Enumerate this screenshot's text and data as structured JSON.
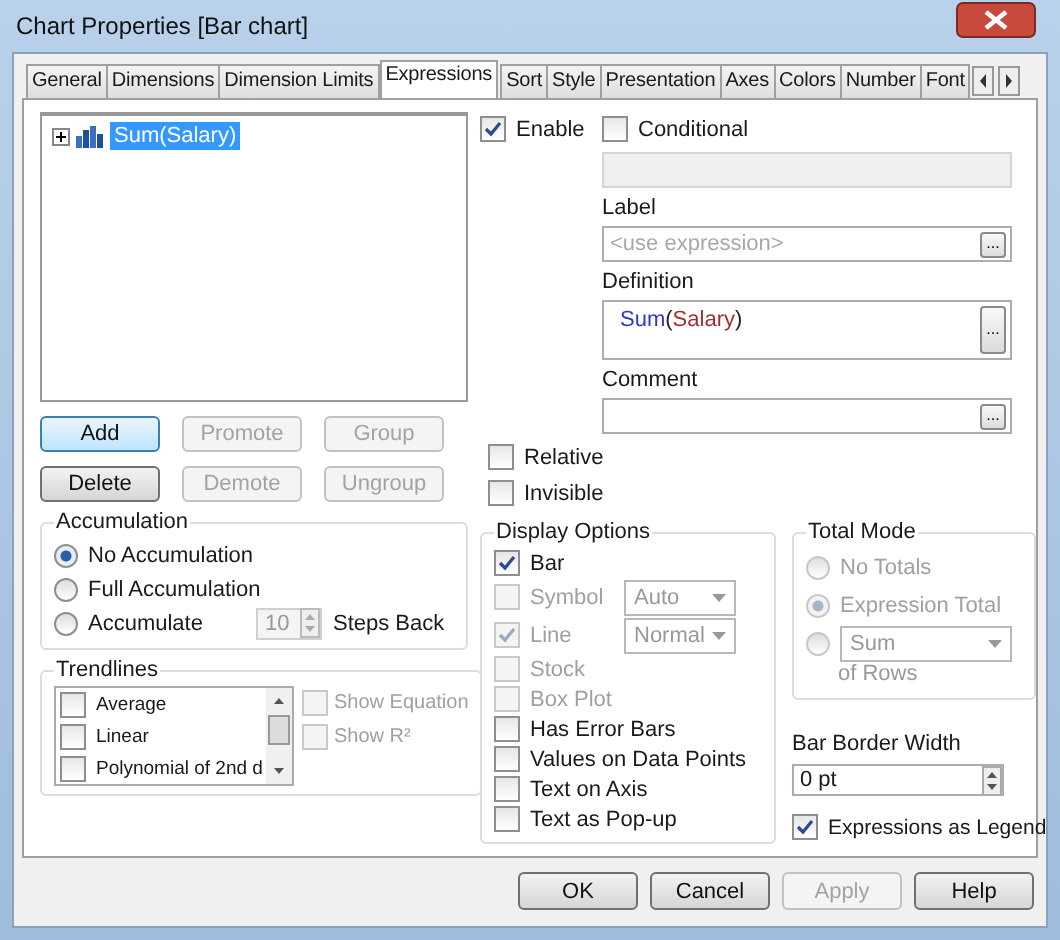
{
  "window": {
    "title": "Chart Properties [Bar chart]"
  },
  "tabs": [
    {
      "label": "General",
      "selected": false
    },
    {
      "label": "Dimensions",
      "selected": false
    },
    {
      "label": "Dimension Limits",
      "selected": false
    },
    {
      "label": "Expressions",
      "selected": true
    },
    {
      "label": "Sort",
      "selected": false
    },
    {
      "label": "Style",
      "selected": false
    },
    {
      "label": "Presentation",
      "selected": false
    },
    {
      "label": "Axes",
      "selected": false
    },
    {
      "label": "Colors",
      "selected": false
    },
    {
      "label": "Number",
      "selected": false
    },
    {
      "label": "Font",
      "selected": false
    }
  ],
  "expression_tree": [
    {
      "label": "Sum(Salary)",
      "selected": true,
      "expanded": false
    }
  ],
  "expression_buttons": [
    {
      "label": "Add",
      "disabled": false,
      "hovered": true
    },
    {
      "label": "Promote",
      "disabled": true,
      "hovered": false
    },
    {
      "label": "Group",
      "disabled": true,
      "hovered": false
    },
    {
      "label": "Delete",
      "disabled": false,
      "hovered": false
    },
    {
      "label": "Demote",
      "disabled": true,
      "hovered": false
    },
    {
      "label": "Ungroup",
      "disabled": true,
      "hovered": false
    }
  ],
  "enable": {
    "label": "Enable",
    "checked": true
  },
  "conditional": {
    "label": "Conditional",
    "checked": false
  },
  "label_field": {
    "heading": "Label",
    "placeholder": "<use expression>",
    "button": "..."
  },
  "definition": {
    "heading": "Definition",
    "parts": [
      {
        "text": "Sum",
        "kind": "function"
      },
      {
        "text": "(",
        "kind": "plain"
      },
      {
        "text": "Salary",
        "kind": "field"
      },
      {
        "text": ")",
        "kind": "plain"
      }
    ],
    "button": "..."
  },
  "comment": {
    "heading": "Comment",
    "button": "..."
  },
  "flags": [
    {
      "label": "Relative",
      "checked": false
    },
    {
      "label": "Invisible",
      "checked": false
    }
  ],
  "accumulation": {
    "title": "Accumulation",
    "options": [
      {
        "label": "No Accumulation",
        "selected": true
      },
      {
        "label": "Full Accumulation",
        "selected": false
      },
      {
        "label": "Accumulate",
        "selected": false
      }
    ],
    "steps": "10",
    "steps_label": "Steps Back"
  },
  "trendlines": {
    "title": "Trendlines",
    "items": [
      {
        "label": "Average",
        "checked": false
      },
      {
        "label": "Linear",
        "checked": false
      },
      {
        "label": "Polynomial of 2nd d",
        "checked": false
      }
    ],
    "show_options": [
      {
        "label": "Show Equation",
        "checked": false,
        "disabled": true
      },
      {
        "label": "Show R²",
        "checked": false,
        "disabled": true
      }
    ]
  },
  "display_options": {
    "title": "Display Options",
    "items": [
      {
        "kind": "checkbox",
        "label": "Bar",
        "checked": true,
        "disabled": false
      },
      {
        "kind": "dropdown",
        "label": "Symbol",
        "checked": false,
        "disabled": true,
        "value": "Auto"
      },
      {
        "kind": "dropdown",
        "label": "Line",
        "checked": true,
        "disabled": true,
        "value": "Normal"
      },
      {
        "kind": "checkbox",
        "label": "Stock",
        "checked": false,
        "disabled": true
      },
      {
        "kind": "checkbox",
        "label": "Box Plot",
        "checked": false,
        "disabled": true
      },
      {
        "kind": "checkbox",
        "label": "Has Error Bars",
        "checked": false,
        "disabled": false
      },
      {
        "kind": "checkbox",
        "label": "Values on Data Points",
        "checked": false,
        "disabled": false
      },
      {
        "kind": "checkbox",
        "label": "Text on Axis",
        "checked": false,
        "disabled": false
      },
      {
        "kind": "checkbox",
        "label": "Text as Pop-up",
        "checked": false,
        "disabled": false
      }
    ]
  },
  "total_mode": {
    "title": "Total Mode",
    "disabled": true,
    "options": [
      {
        "kind": "radio",
        "label": "No Totals",
        "selected": false
      },
      {
        "kind": "radio",
        "label": "Expression Total",
        "selected": true
      },
      {
        "kind": "dropdown",
        "value": "Sum",
        "selected": false
      }
    ],
    "suffix": "of Rows"
  },
  "bar_border_width": {
    "label": "Bar Border Width",
    "value": "0 pt"
  },
  "expressions_as_legend": {
    "label": "Expressions as Legend",
    "checked": true
  },
  "footer_buttons": [
    {
      "label": "OK",
      "disabled": false
    },
    {
      "label": "Cancel",
      "disabled": false
    },
    {
      "label": "Apply",
      "disabled": true
    },
    {
      "label": "Help",
      "disabled": false
    }
  ]
}
